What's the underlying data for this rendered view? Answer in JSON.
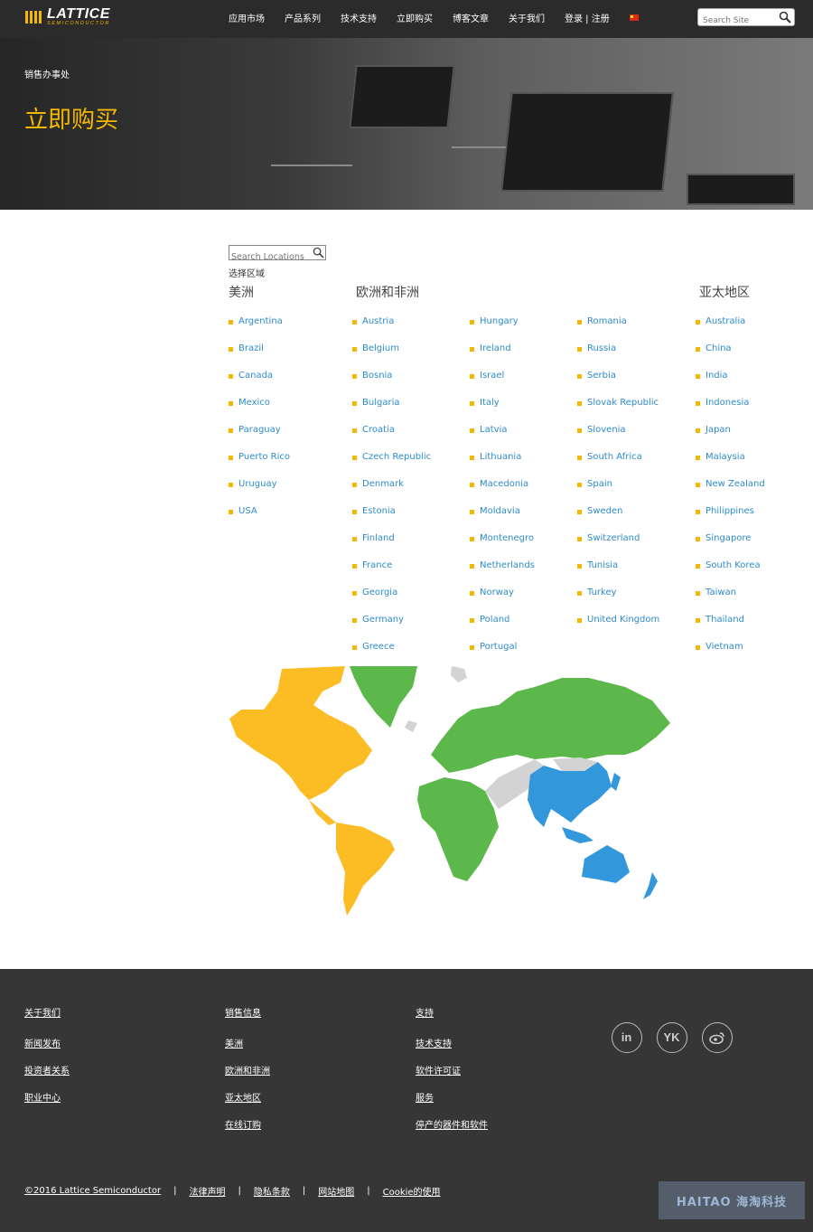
{
  "header": {
    "logo_brand": "LATTICE",
    "logo_sub": "SEMICONDUCTOR",
    "nav": [
      "应用市场",
      "产品系列",
      "技术支持",
      "立即购买",
      "博客文章",
      "关于我们"
    ],
    "login": "登录 | 注册",
    "search_placeholder": "Search Site",
    "flag_color": "#de2910"
  },
  "hero": {
    "breadcrumb": "销售办事处",
    "title": "立即购买"
  },
  "locations": {
    "search_placeholder": "Search Locations",
    "region_label": "选择区域",
    "headings": {
      "americas": "美洲",
      "emea": "欧洲和非洲",
      "apac": "亚太地区"
    },
    "americas": [
      "Argentina",
      "Brazil",
      "Canada",
      "Mexico",
      "Paraguay",
      "Puerto Rico",
      "Uruguay",
      "USA"
    ],
    "emea_col1": [
      "Austria",
      "Belgium",
      "Bosnia",
      "Bulgaria",
      "Croatia",
      "Czech Republic",
      "Denmark",
      "Estonia",
      "Finland",
      "France",
      "Georgia",
      "Germany",
      "Greece"
    ],
    "emea_col2": [
      "Hungary",
      "Ireland",
      "Israel",
      "Italy",
      "Latvia",
      "Lithuania",
      "Macedonia",
      "Moldavia",
      "Montenegro",
      "Netherlands",
      "Norway",
      "Poland",
      "Portugal"
    ],
    "emea_col3": [
      "Romania",
      "Russia",
      "Serbia",
      "Slovak Republic",
      "Slovenia",
      "South Africa",
      "Spain",
      "Sweden",
      "Switzerland",
      "Tunisia",
      "Turkey",
      "United Kingdom"
    ],
    "apac": [
      "Australia",
      "China",
      "India",
      "Indonesia",
      "Japan",
      "Malaysia",
      "New Zealand",
      "Philippines",
      "Singapore",
      "South Korea",
      "Taiwan",
      "Thailand",
      "Vietnam"
    ],
    "map_colors": {
      "americas": "#fbbc24",
      "emea": "#5cb84a",
      "apac": "#3398db",
      "other": "#d3d3d3"
    }
  },
  "footer": {
    "col1": {
      "head": "关于我们",
      "links": [
        "新闻发布",
        "投资者关系",
        "职业中心"
      ]
    },
    "col2": {
      "head": "销售信息",
      "links": [
        "美洲",
        "欧洲和非洲",
        "亚太地区",
        "在线订购"
      ]
    },
    "col3": {
      "head": "支持",
      "links": [
        "技术支持",
        "软件许可证",
        "服务",
        "停产的器件和软件"
      ]
    },
    "social": {
      "linkedin": "in",
      "youku": "YK",
      "weibo_icon": "weibo-icon"
    },
    "copyright": "©2016 Lattice Semiconductor",
    "legal_links": [
      "法律声明",
      "隐私条款",
      "网站地图",
      "Cookie的使用"
    ],
    "separator": "|",
    "watermark": "HAITAO 海淘科技"
  }
}
